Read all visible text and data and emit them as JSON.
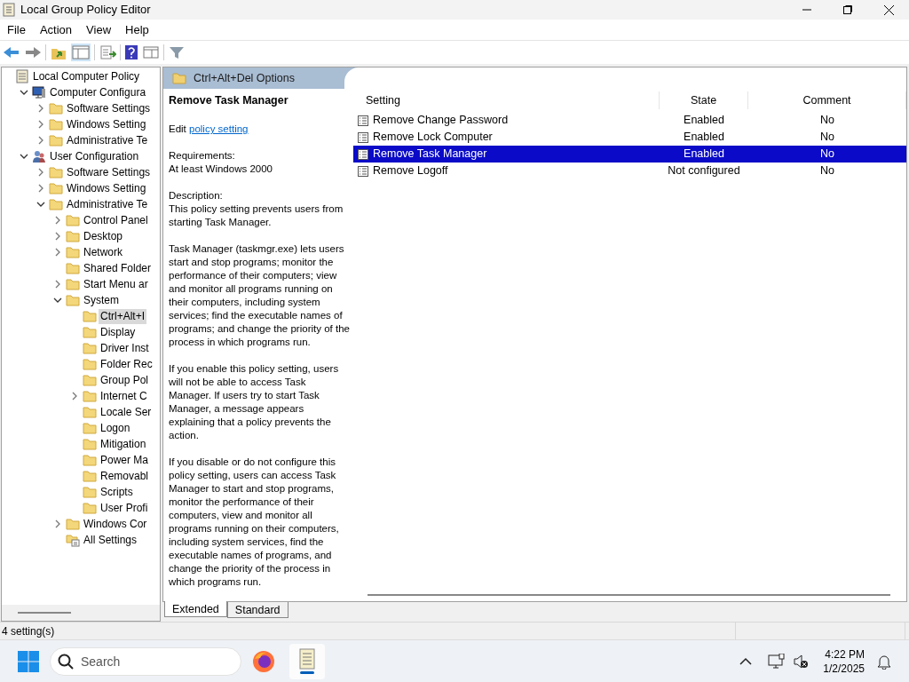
{
  "window": {
    "title": "Local Group Policy Editor"
  },
  "menu": [
    "File",
    "Action",
    "View",
    "Help"
  ],
  "tree": [
    {
      "label": "Local Computer Policy",
      "kind": "policy",
      "children": [
        {
          "label": "Computer Configura",
          "kind": "computer",
          "expanded": true,
          "children": [
            {
              "label": "Software Settings",
              "kind": "folder",
              "expanded": false
            },
            {
              "label": "Windows Setting",
              "kind": "folder",
              "expanded": false
            },
            {
              "label": "Administrative Te",
              "kind": "folder",
              "expanded": false
            }
          ]
        },
        {
          "label": "User Configuration",
          "kind": "user",
          "expanded": true,
          "children": [
            {
              "label": "Software Settings",
              "kind": "folder",
              "expanded": false
            },
            {
              "label": "Windows Setting",
              "kind": "folder",
              "expanded": false
            },
            {
              "label": "Administrative Te",
              "kind": "folder",
              "expanded": true,
              "children": [
                {
                  "label": "Control Panel",
                  "kind": "folder",
                  "expanded": false
                },
                {
                  "label": "Desktop",
                  "kind": "folder",
                  "expanded": false
                },
                {
                  "label": "Network",
                  "kind": "folder",
                  "expanded": false
                },
                {
                  "label": "Shared Folder",
                  "kind": "folder"
                },
                {
                  "label": "Start Menu ar",
                  "kind": "folder",
                  "expanded": false
                },
                {
                  "label": "System",
                  "kind": "folder",
                  "expanded": true,
                  "children": [
                    {
                      "label": "Ctrl+Alt+I",
                      "kind": "folder",
                      "selected": true
                    },
                    {
                      "label": "Display",
                      "kind": "folder",
                      "selected": false
                    },
                    {
                      "label": "Driver Inst",
                      "kind": "folder",
                      "selected": false
                    },
                    {
                      "label": "Folder Rec",
                      "kind": "folder",
                      "selected": false
                    },
                    {
                      "label": "Group Pol",
                      "kind": "folder",
                      "selected": false
                    },
                    {
                      "label": "Internet C",
                      "kind": "folder",
                      "expanded": false,
                      "selected": false
                    },
                    {
                      "label": "Locale Ser",
                      "kind": "folder",
                      "selected": false
                    },
                    {
                      "label": "Logon",
                      "kind": "folder",
                      "selected": false
                    },
                    {
                      "label": "Mitigation",
                      "kind": "folder",
                      "selected": false
                    },
                    {
                      "label": "Power Ma",
                      "kind": "folder",
                      "selected": false
                    },
                    {
                      "label": "Removabl",
                      "kind": "folder",
                      "selected": false
                    },
                    {
                      "label": "Scripts",
                      "kind": "folder",
                      "selected": false
                    },
                    {
                      "label": "User Profi",
                      "kind": "folder",
                      "selected": false
                    }
                  ]
                },
                {
                  "label": "Windows Cor",
                  "kind": "folder",
                  "expanded": false
                },
                {
                  "label": "All Settings",
                  "kind": "all-settings"
                }
              ]
            }
          ]
        }
      ]
    }
  ],
  "header": {
    "title": "Ctrl+Alt+Del Options"
  },
  "description": {
    "title": "Remove Task Manager",
    "edit_prefix": "Edit",
    "edit_link": "policy setting",
    "requirements_label": "Requirements:",
    "requirements": "At least Windows 2000",
    "description_label": "Description:",
    "paragraphs": [
      "This policy setting prevents users from starting Task Manager.",
      "Task Manager (taskmgr.exe) lets users start and stop programs; monitor the performance of their computers; view and monitor all programs running on their computers, including system services; find the executable names of programs; and change the priority of the process in which programs run.",
      "If you enable this policy setting, users will not be able to access Task Manager. If users try to start Task Manager, a message appears explaining that a policy prevents the action.",
      "If you disable or do not configure this policy setting, users can access Task Manager to  start and stop programs, monitor the performance of their computers, view and monitor all programs running on their computers, including system services, find the executable names of programs, and change the priority of the process in which programs run."
    ]
  },
  "table": {
    "columns": [
      "Setting",
      "State",
      "Comment"
    ],
    "rows": [
      {
        "setting": "Remove Change Password",
        "state": "Enabled",
        "comment": "No",
        "selected": false
      },
      {
        "setting": "Remove Lock Computer",
        "state": "Enabled",
        "comment": "No",
        "selected": false
      },
      {
        "setting": "Remove Task Manager",
        "state": "Enabled",
        "comment": "No",
        "selected": true
      },
      {
        "setting": "Remove Logoff",
        "state": "Not configured",
        "comment": "No",
        "selected": false
      }
    ]
  },
  "view_tabs": [
    {
      "label": "Extended",
      "selected": true
    },
    {
      "label": "Standard",
      "selected": false
    }
  ],
  "status_bar": "4 setting(s)",
  "taskbar": {
    "search_placeholder": "Search",
    "time": "4:22 PM",
    "date": "1/2/2025"
  }
}
